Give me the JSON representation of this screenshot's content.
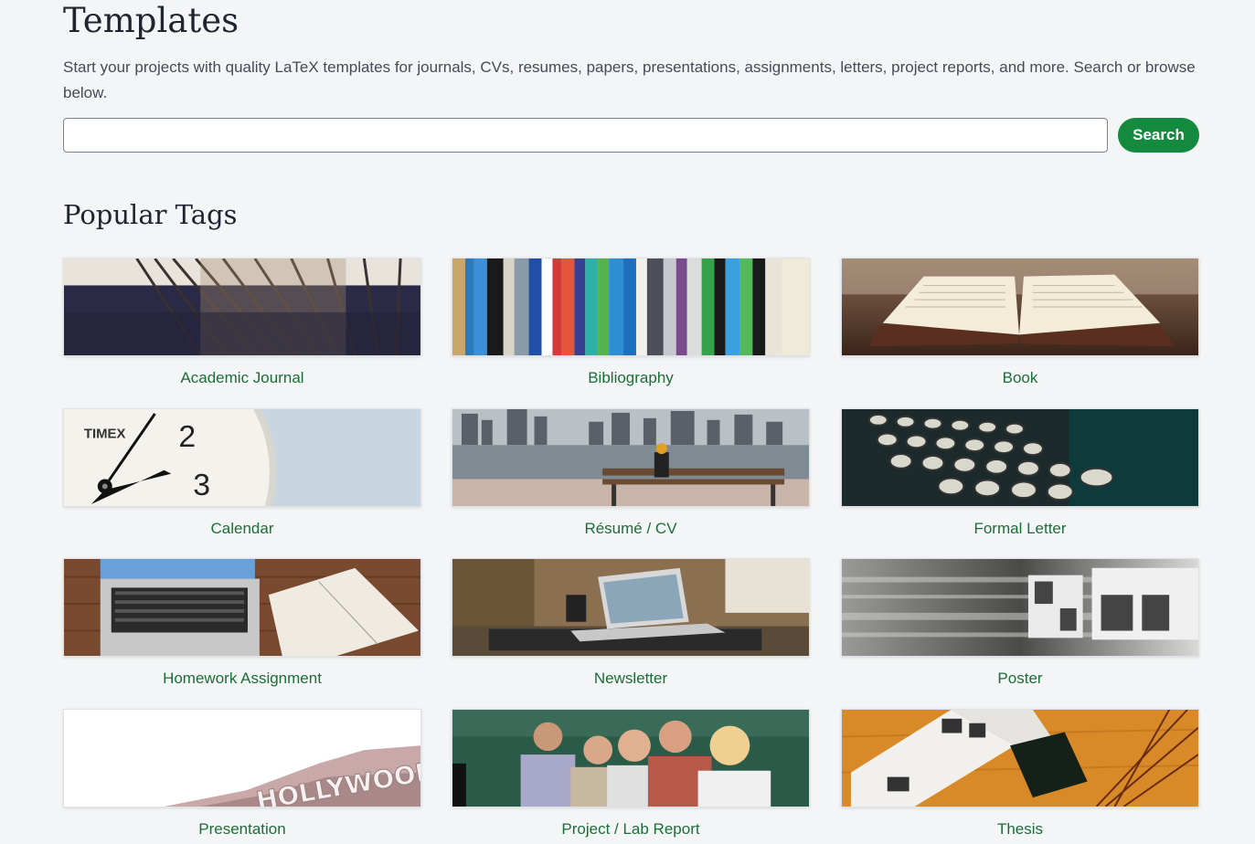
{
  "header": {
    "title": "Templates",
    "intro": "Start your projects with quality LaTeX templates for journals, CVs, resumes, papers, presentations, assignments, letters, project reports, and more. Search or browse below."
  },
  "search": {
    "value": "",
    "placeholder": "",
    "button_label": "Search"
  },
  "popular_tags": {
    "title": "Popular Tags",
    "items": [
      {
        "label": "Academic Journal",
        "icon": "library-shelves-image"
      },
      {
        "label": "Bibliography",
        "icon": "book-spines-image"
      },
      {
        "label": "Book",
        "icon": "open-book-image"
      },
      {
        "label": "Calendar",
        "icon": "clock-image"
      },
      {
        "label": "Résumé / CV",
        "icon": "city-bench-image"
      },
      {
        "label": "Formal Letter",
        "icon": "typewriter-image"
      },
      {
        "label": "Homework Assignment",
        "icon": "laptop-notebook-image"
      },
      {
        "label": "Newsletter",
        "icon": "laptop-desk-image"
      },
      {
        "label": "Poster",
        "icon": "posters-blur-image"
      },
      {
        "label": "Presentation",
        "icon": "hollywood-sign-image"
      },
      {
        "label": "Project / Lab Report",
        "icon": "students-image"
      },
      {
        "label": "Thesis",
        "icon": "open-magazine-image"
      }
    ],
    "image_text": {
      "timex": "TIMEX",
      "hollywood": "HOLLYWOOD"
    }
  },
  "colors": {
    "accent": "#138a3d",
    "link": "#1b6e38",
    "background": "#f4f5f6"
  }
}
